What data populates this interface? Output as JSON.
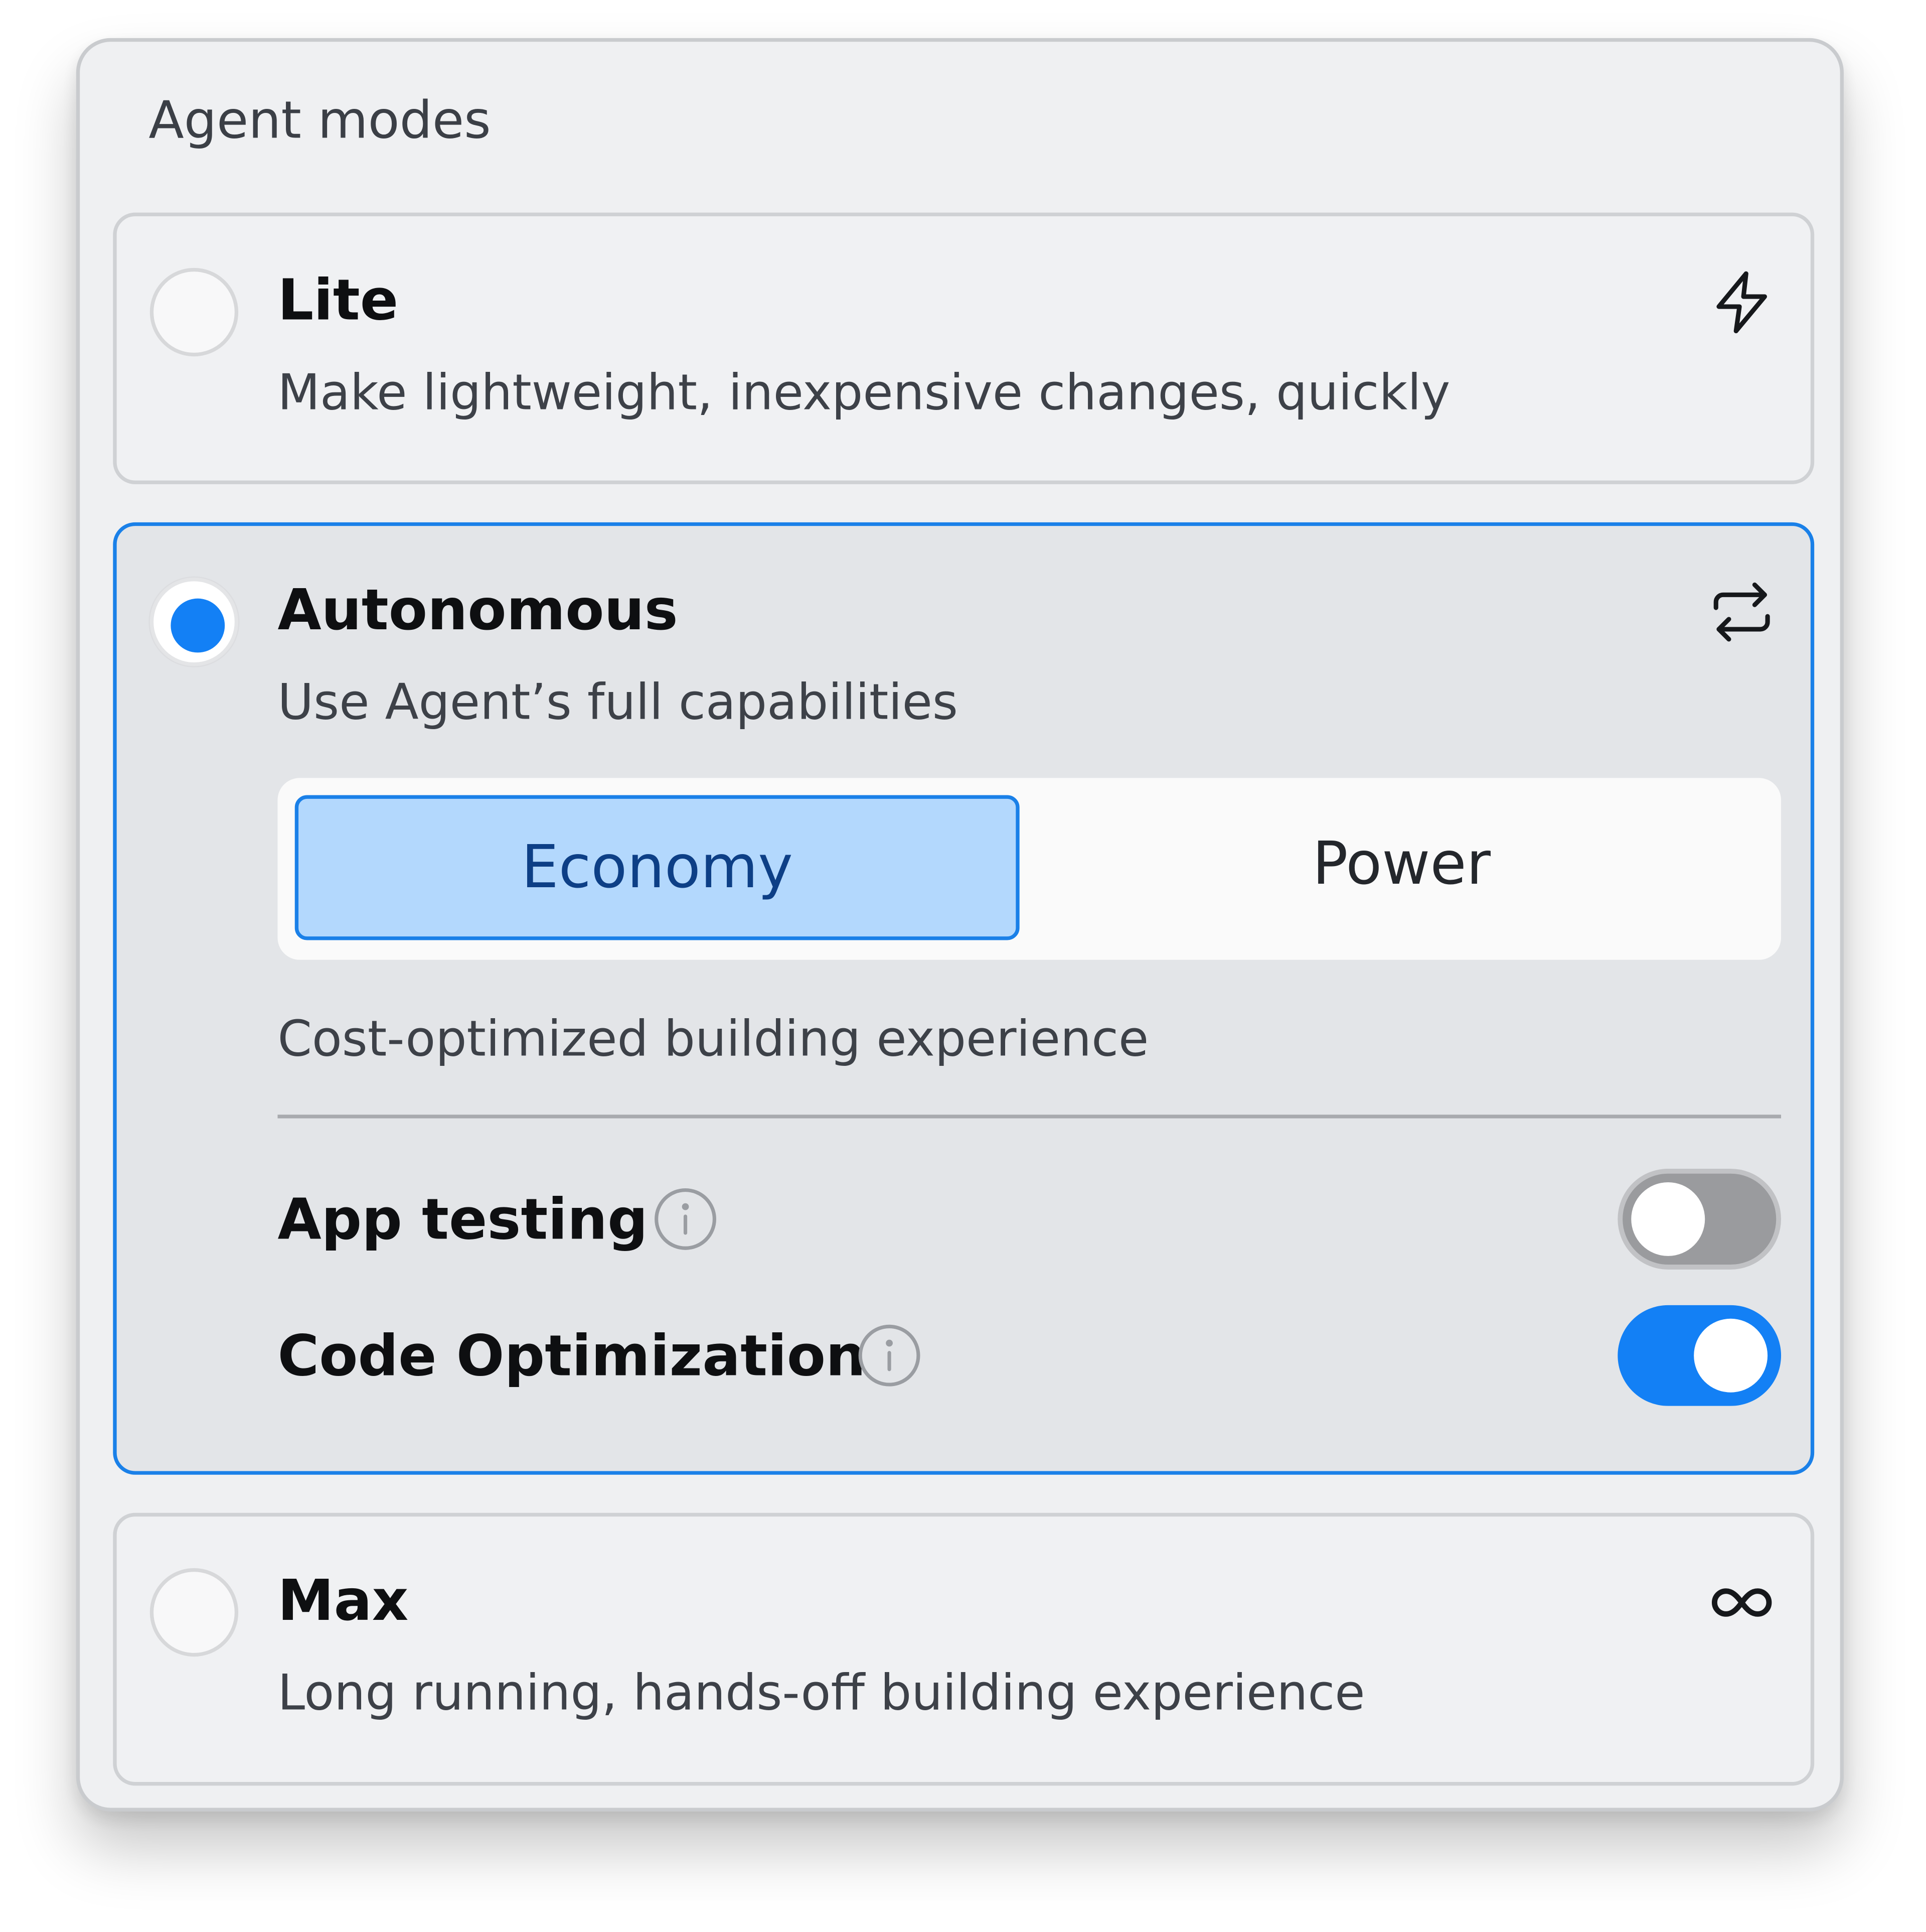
{
  "panel": {
    "title": "Agent modes"
  },
  "modes": [
    {
      "id": "lite",
      "title": "Lite",
      "description": "Make lightweight, inexpensive changes, quickly",
      "icon": "lightning-bolt-icon",
      "selected": false
    },
    {
      "id": "autonomous",
      "title": "Autonomous",
      "description": "Use Agent’s full capabilities",
      "icon": "swap-arrows-icon",
      "selected": true,
      "variant_options": [
        "Economy",
        "Power"
      ],
      "selected_variant": "Economy",
      "variant_description": "Cost-optimized building experience",
      "settings": [
        {
          "label": "App testing",
          "enabled": false,
          "info_icon": "info-icon"
        },
        {
          "label": "Code Optimization",
          "enabled": true,
          "info_icon": "info-icon"
        }
      ]
    },
    {
      "id": "max",
      "title": "Max",
      "description": "Long running, hands-off building experience",
      "icon": "infinity-icon",
      "selected": false
    }
  ],
  "colors": {
    "accent": "#1380f5",
    "selected_border": "#1a80e8",
    "selected_segment_bg": "#b3d8fd",
    "panel_bg": "#eff0f2",
    "toggle_off": "#9a9b9e"
  }
}
